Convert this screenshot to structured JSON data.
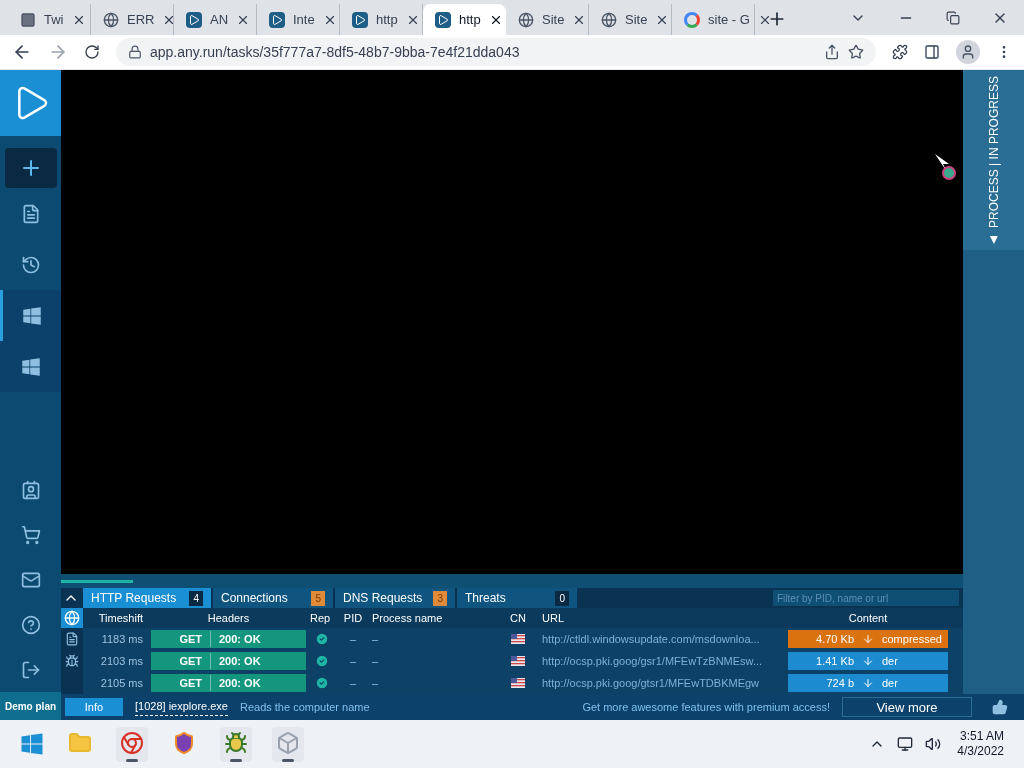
{
  "browser": {
    "tabs": [
      {
        "title": "Twi",
        "selected": false,
        "kind": "app"
      },
      {
        "title": "ERR",
        "selected": false,
        "kind": "globe"
      },
      {
        "title": "AN",
        "selected": false,
        "kind": "anyrun"
      },
      {
        "title": "Inte",
        "selected": false,
        "kind": "anyrun"
      },
      {
        "title": "http",
        "selected": false,
        "kind": "anyrun"
      },
      {
        "title": "http",
        "selected": true,
        "kind": "anyrun"
      },
      {
        "title": "Site",
        "selected": false,
        "kind": "globe"
      },
      {
        "title": "Site",
        "selected": false,
        "kind": "globe"
      },
      {
        "title": "site - G",
        "selected": false,
        "kind": "google"
      }
    ],
    "address": "app.any.run/tasks/35f777a7-8df5-48b7-9bba-7e4f21dda043"
  },
  "sidebar": {
    "footer": "Demo plan"
  },
  "side_panel": {
    "label": "PROCESS | IN PROGRESS"
  },
  "progress": {
    "level": 0.08
  },
  "panel": {
    "tabs": [
      {
        "label": "HTTP Requests",
        "count": "4",
        "selected": true,
        "highlight": false
      },
      {
        "label": "Connections",
        "count": "5",
        "selected": false,
        "highlight": true
      },
      {
        "label": "DNS Requests",
        "count": "3",
        "selected": false,
        "highlight": true
      },
      {
        "label": "Threats",
        "count": "0",
        "selected": false,
        "highlight": false
      }
    ],
    "filter_placeholder": "Filter by PID, name or url",
    "columns": [
      "Timeshift",
      "Headers",
      "Rep",
      "PID",
      "Process name",
      "CN",
      "URL",
      "Content"
    ],
    "rows": [
      {
        "timeshift": "1183 ms",
        "method": "GET",
        "status": "200: OK",
        "pid": "–",
        "process": "–",
        "url": "http://ctldl.windowsupdate.com/msdownloa...",
        "size": "4.70 Kb",
        "type": "compressed",
        "color": "#d9720f"
      },
      {
        "timeshift": "2103 ms",
        "method": "GET",
        "status": "200: OK",
        "pid": "–",
        "process": "–",
        "url": "http://ocsp.pki.goog/gsr1/MFEwTzBNMEsw...",
        "size": "1.41 Kb",
        "type": "der",
        "color": "#1c8bd0"
      },
      {
        "timeshift": "2105 ms",
        "method": "GET",
        "status": "200: OK",
        "pid": "–",
        "process": "–",
        "url": "http://ocsp.pki.goog/gtsr1/MFEwTDBKMEgw",
        "size": "724 b",
        "type": "der",
        "color": "#1c8bd0"
      }
    ]
  },
  "info_bar": {
    "button": "Info",
    "process": "[1028] iexplore.exe",
    "message": "Reads the computer name",
    "promo": "Get more awesome features with premium access!",
    "view_more": "View more"
  },
  "taskbar": {
    "apps": [
      {
        "kind": "explorer",
        "open": false
      },
      {
        "kind": "chrome",
        "open": true
      },
      {
        "kind": "shield",
        "open": false
      },
      {
        "kind": "bug",
        "open": true
      },
      {
        "kind": "box",
        "open": true
      }
    ],
    "time": "3:51 AM",
    "date": "4/3/2022"
  }
}
